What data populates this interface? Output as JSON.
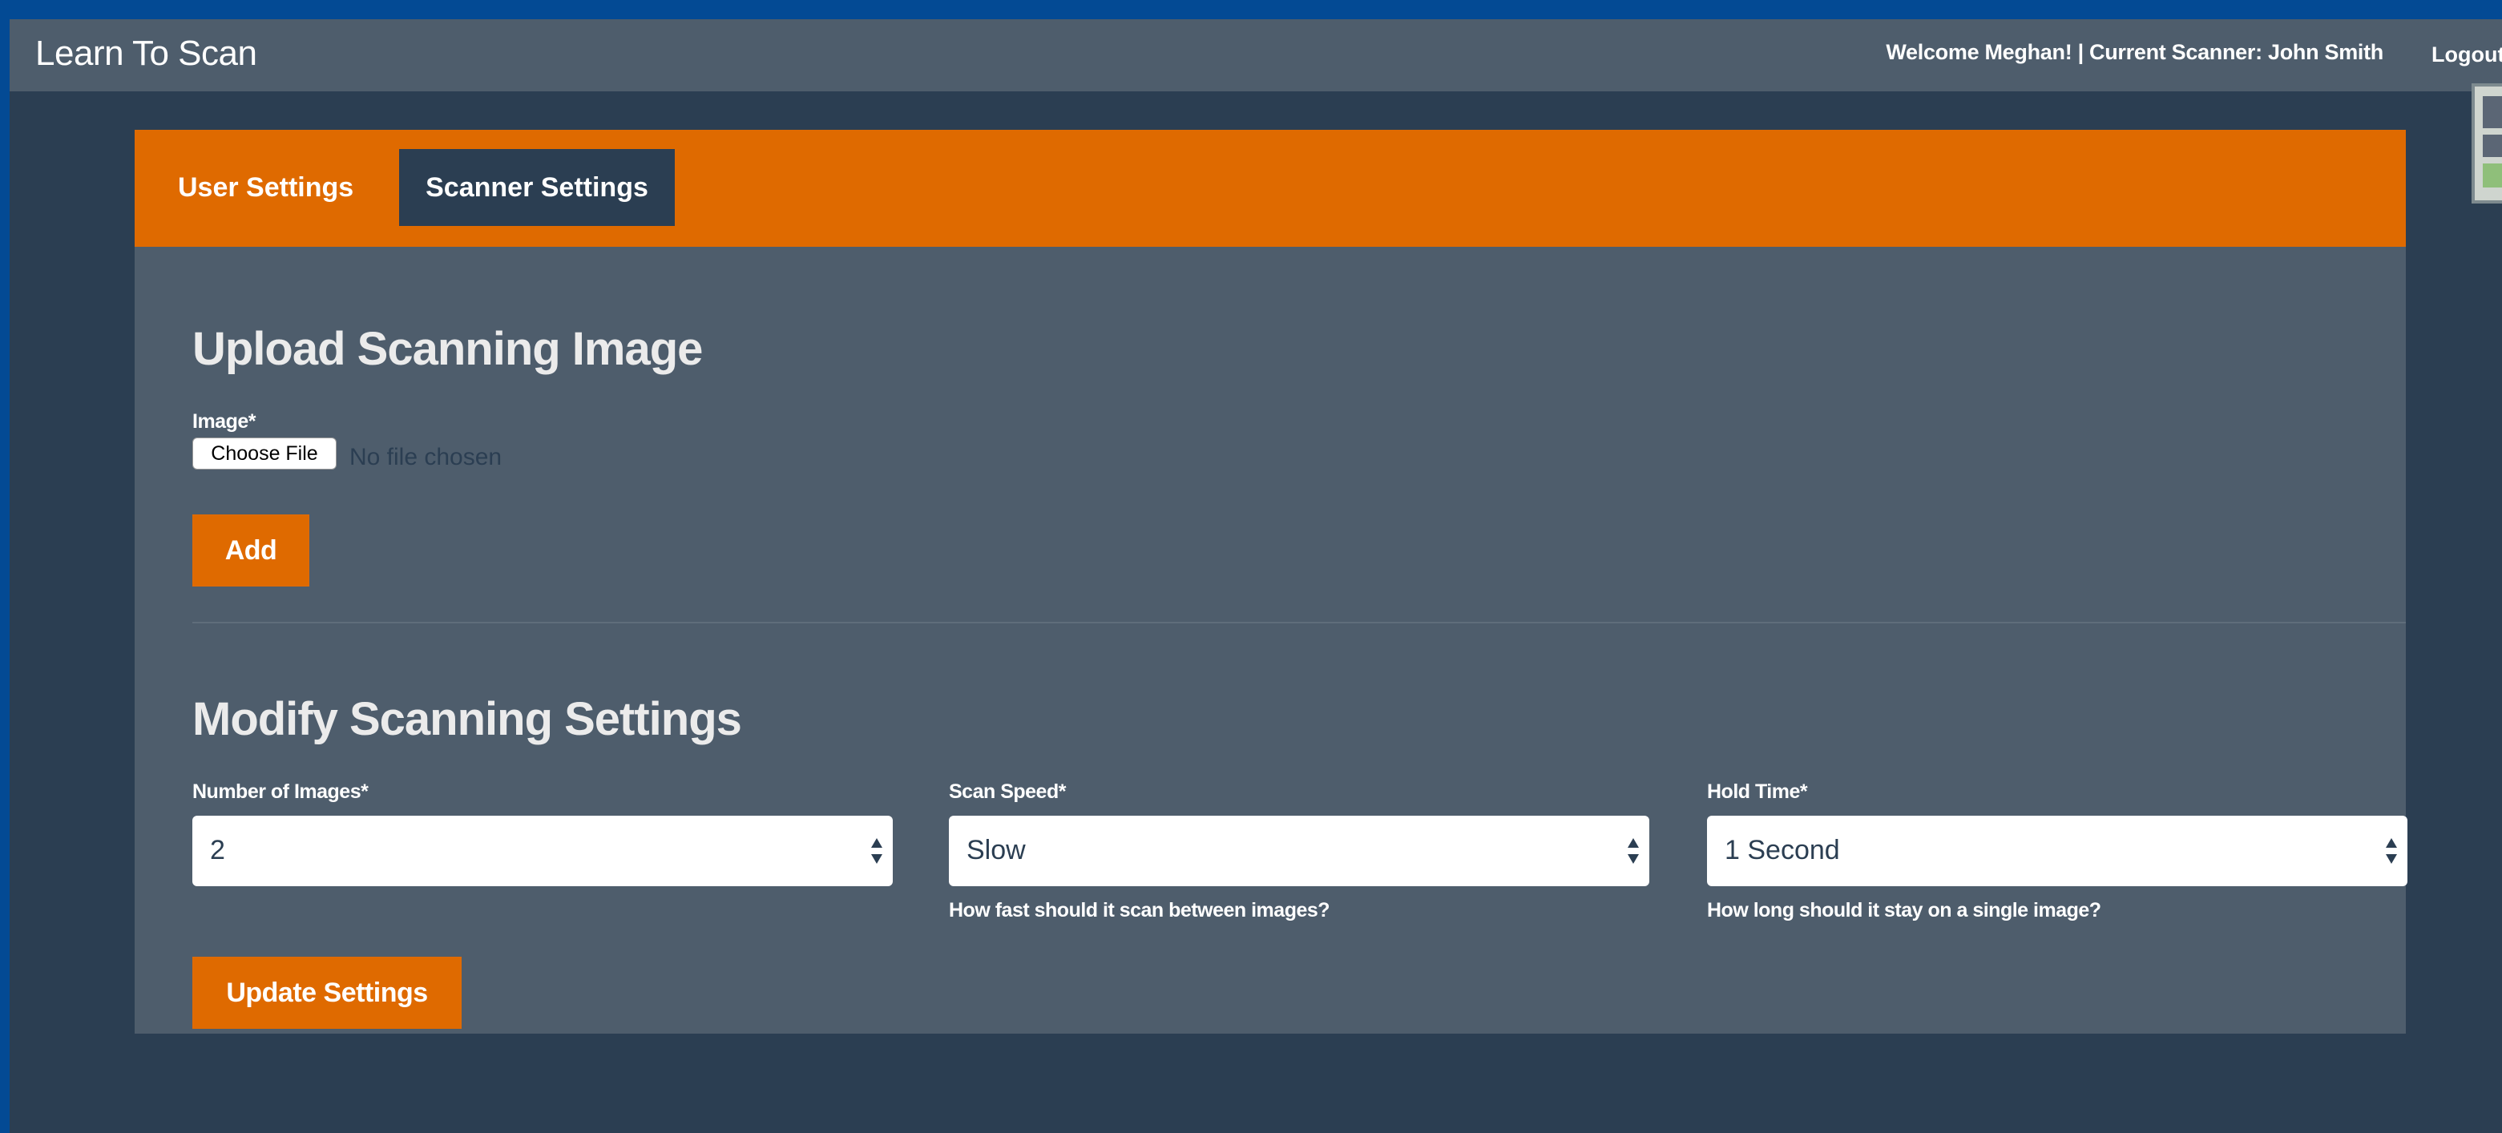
{
  "navbar": {
    "brand": "Learn To Scan",
    "welcome": "Welcome Meghan! | Current Scanner: John Smith",
    "logout": "Logout"
  },
  "tabs": [
    {
      "label": "User Settings",
      "active": false
    },
    {
      "label": "Scanner Settings",
      "active": true
    }
  ],
  "upload": {
    "title": "Upload Scanning Image",
    "image_label": "Image*",
    "choose_file_label": "Choose File",
    "file_status": "No file chosen",
    "add_label": "Add"
  },
  "settings": {
    "title": "Modify Scanning Settings",
    "number_of_images": {
      "label": "Number of Images*",
      "value": "2"
    },
    "scan_speed": {
      "label": "Scan Speed*",
      "value": "Slow",
      "help": "How fast should it scan between images?"
    },
    "hold_time": {
      "label": "Hold Time*",
      "value": "1 Second",
      "help": "How long should it stay on a single image?"
    },
    "update_label": "Update Settings"
  },
  "colors": {
    "outer": "#034a94",
    "page": "#2b3e52",
    "navbar": "#4e5d6c",
    "accent": "#df6a00",
    "panel": "#4e5d6c"
  }
}
